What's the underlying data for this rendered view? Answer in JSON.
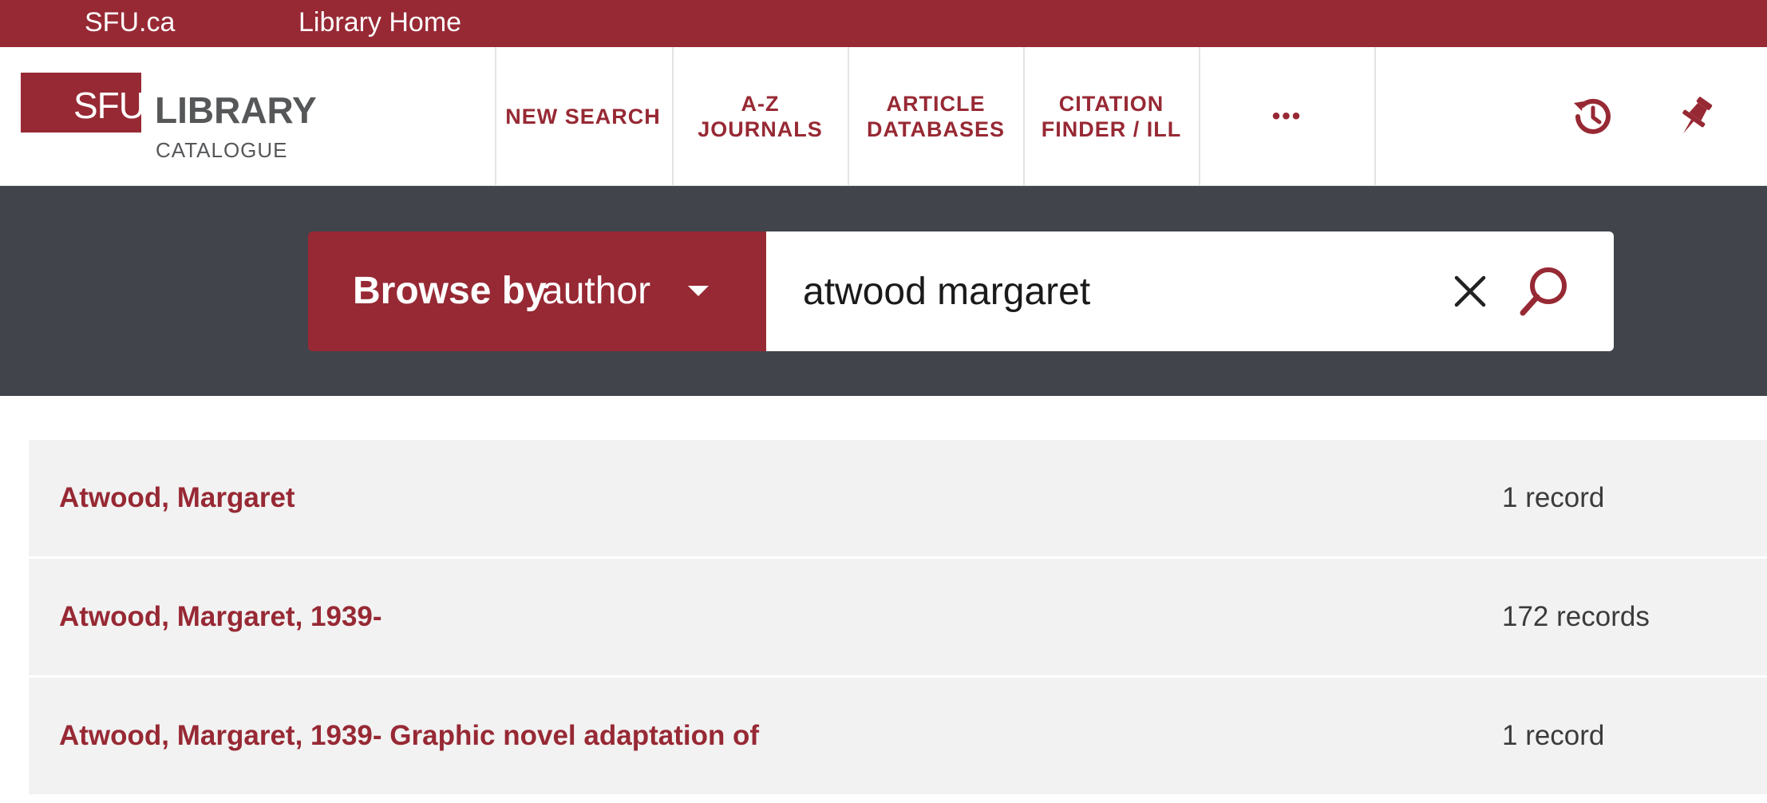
{
  "topbar": {
    "links": [
      "SFU.ca",
      "Library Home"
    ]
  },
  "logo": {
    "mark": "SFU",
    "name": "LIBRARY",
    "subtitle": "CATALOGUE"
  },
  "nav": {
    "items": [
      {
        "label": "NEW SEARCH"
      },
      {
        "label": "A-Z\nJOURNALS"
      },
      {
        "label": "ARTICLE\nDATABASES"
      },
      {
        "label": "CITATION\nFINDER / ILL"
      },
      {
        "label": "•••"
      }
    ],
    "icons": [
      "history-icon",
      "pin-icon"
    ]
  },
  "search": {
    "browse_prefix": "Browse by",
    "browse_field": "author",
    "query": "atwood margaret"
  },
  "results": [
    {
      "name": "Atwood, Margaret",
      "count": "1 record"
    },
    {
      "name": "Atwood, Margaret, 1939-",
      "count": "172 records"
    },
    {
      "name": "Atwood, Margaret, 1939- Graphic novel adaptation of",
      "count": "1 record"
    }
  ],
  "colors": {
    "brand": "#972934",
    "band": "#41444b",
    "row_bg": "#f2f2f2"
  }
}
